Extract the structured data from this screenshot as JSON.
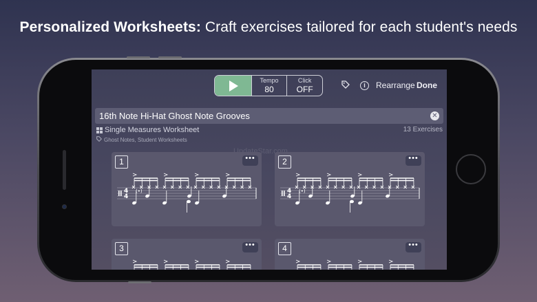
{
  "headline": {
    "bold": "Personalized Worksheets:",
    "rest": " Craft exercises tailored for each student's needs"
  },
  "toolbar": {
    "play_icon": "play-icon",
    "tempo_label": "Tempo",
    "tempo_value": "80",
    "click_label": "Click",
    "click_value": "OFF",
    "tag_icon": "tag-icon",
    "info_icon": "info-icon",
    "info_glyph": "i",
    "rearrange_label": "Rearrange",
    "done_label": "Done"
  },
  "worksheet": {
    "title": "16th Note Hi-Hat Ghost Note Grooves",
    "type": "Single Measures Worksheet",
    "exercise_count": "13 Exercises",
    "tags": "Ghost Notes, Student Worksheets"
  },
  "watermark": "UpdateStar.com",
  "exercises": [
    {
      "number": "1",
      "more": "•••"
    },
    {
      "number": "2",
      "more": "•••"
    },
    {
      "number": "3",
      "more": "•••"
    },
    {
      "number": "4",
      "more": "•••"
    }
  ],
  "colors": {
    "play_green": "#7fb893",
    "screen_bg": "#494860",
    "card_bg": "#5a586d"
  }
}
